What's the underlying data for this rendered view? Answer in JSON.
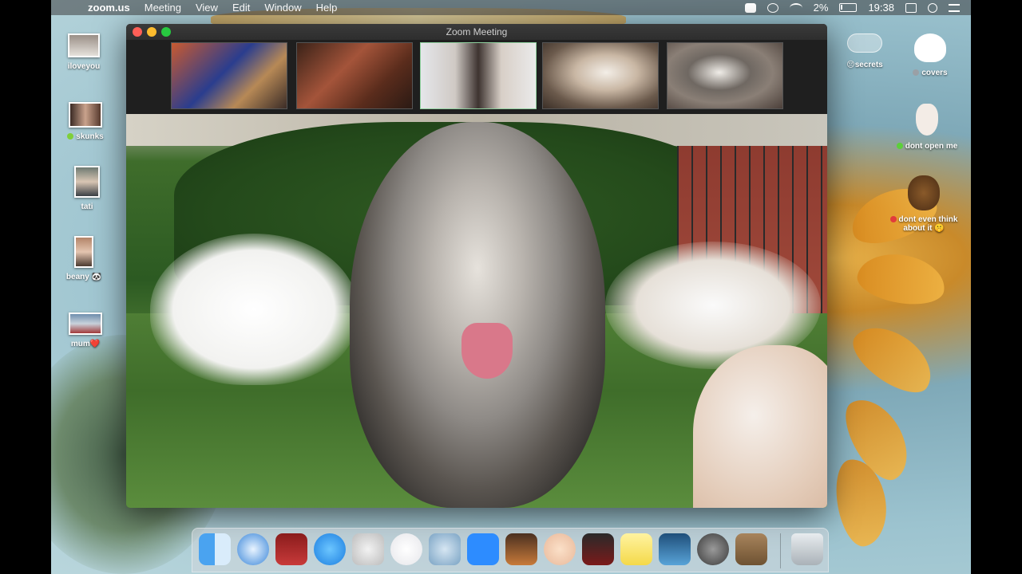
{
  "menubar": {
    "app_name": "zoom.us",
    "menus": [
      "Meeting",
      "View",
      "Edit",
      "Window",
      "Help"
    ],
    "battery": "2%",
    "clock": "19:38"
  },
  "desktop_left": [
    {
      "label": "iloveyou",
      "status": ""
    },
    {
      "label": "skunks",
      "status": "green"
    },
    {
      "label": "tati",
      "status": "🌊"
    },
    {
      "label": "beany 🐼",
      "status": ""
    },
    {
      "label": "mum❤️",
      "status": ""
    }
  ],
  "desktop_right": [
    {
      "label": "😔secrets",
      "status": ""
    },
    {
      "label": "covers",
      "status": "gray"
    },
    {
      "label": "dont open me",
      "status": "green"
    },
    {
      "label": "dont even think about it 🤫",
      "status": "red"
    }
  ],
  "zoom": {
    "title": "Zoom Meeting",
    "participants": [
      "dog-armchair",
      "person-guitar",
      "person-woman",
      "dog-terrier",
      "dog-husky"
    ]
  },
  "dock": {
    "apps": [
      "finder-icon",
      "safari-icon",
      "photo-booth-icon",
      "messages-icon",
      "pets-app-icon",
      "music-icon",
      "seal-app-icon",
      "zoom-icon",
      "guitar-app-icon",
      "face-app-icon",
      "flashcard-app-icon",
      "stickies-icon",
      "preview-icon",
      "system-preferences-icon",
      "contacts-icon",
      "trash-icon"
    ]
  },
  "colors": {
    "traffic_red": "#ff5f57",
    "traffic_yellow": "#febc2e",
    "traffic_green": "#28c840"
  }
}
